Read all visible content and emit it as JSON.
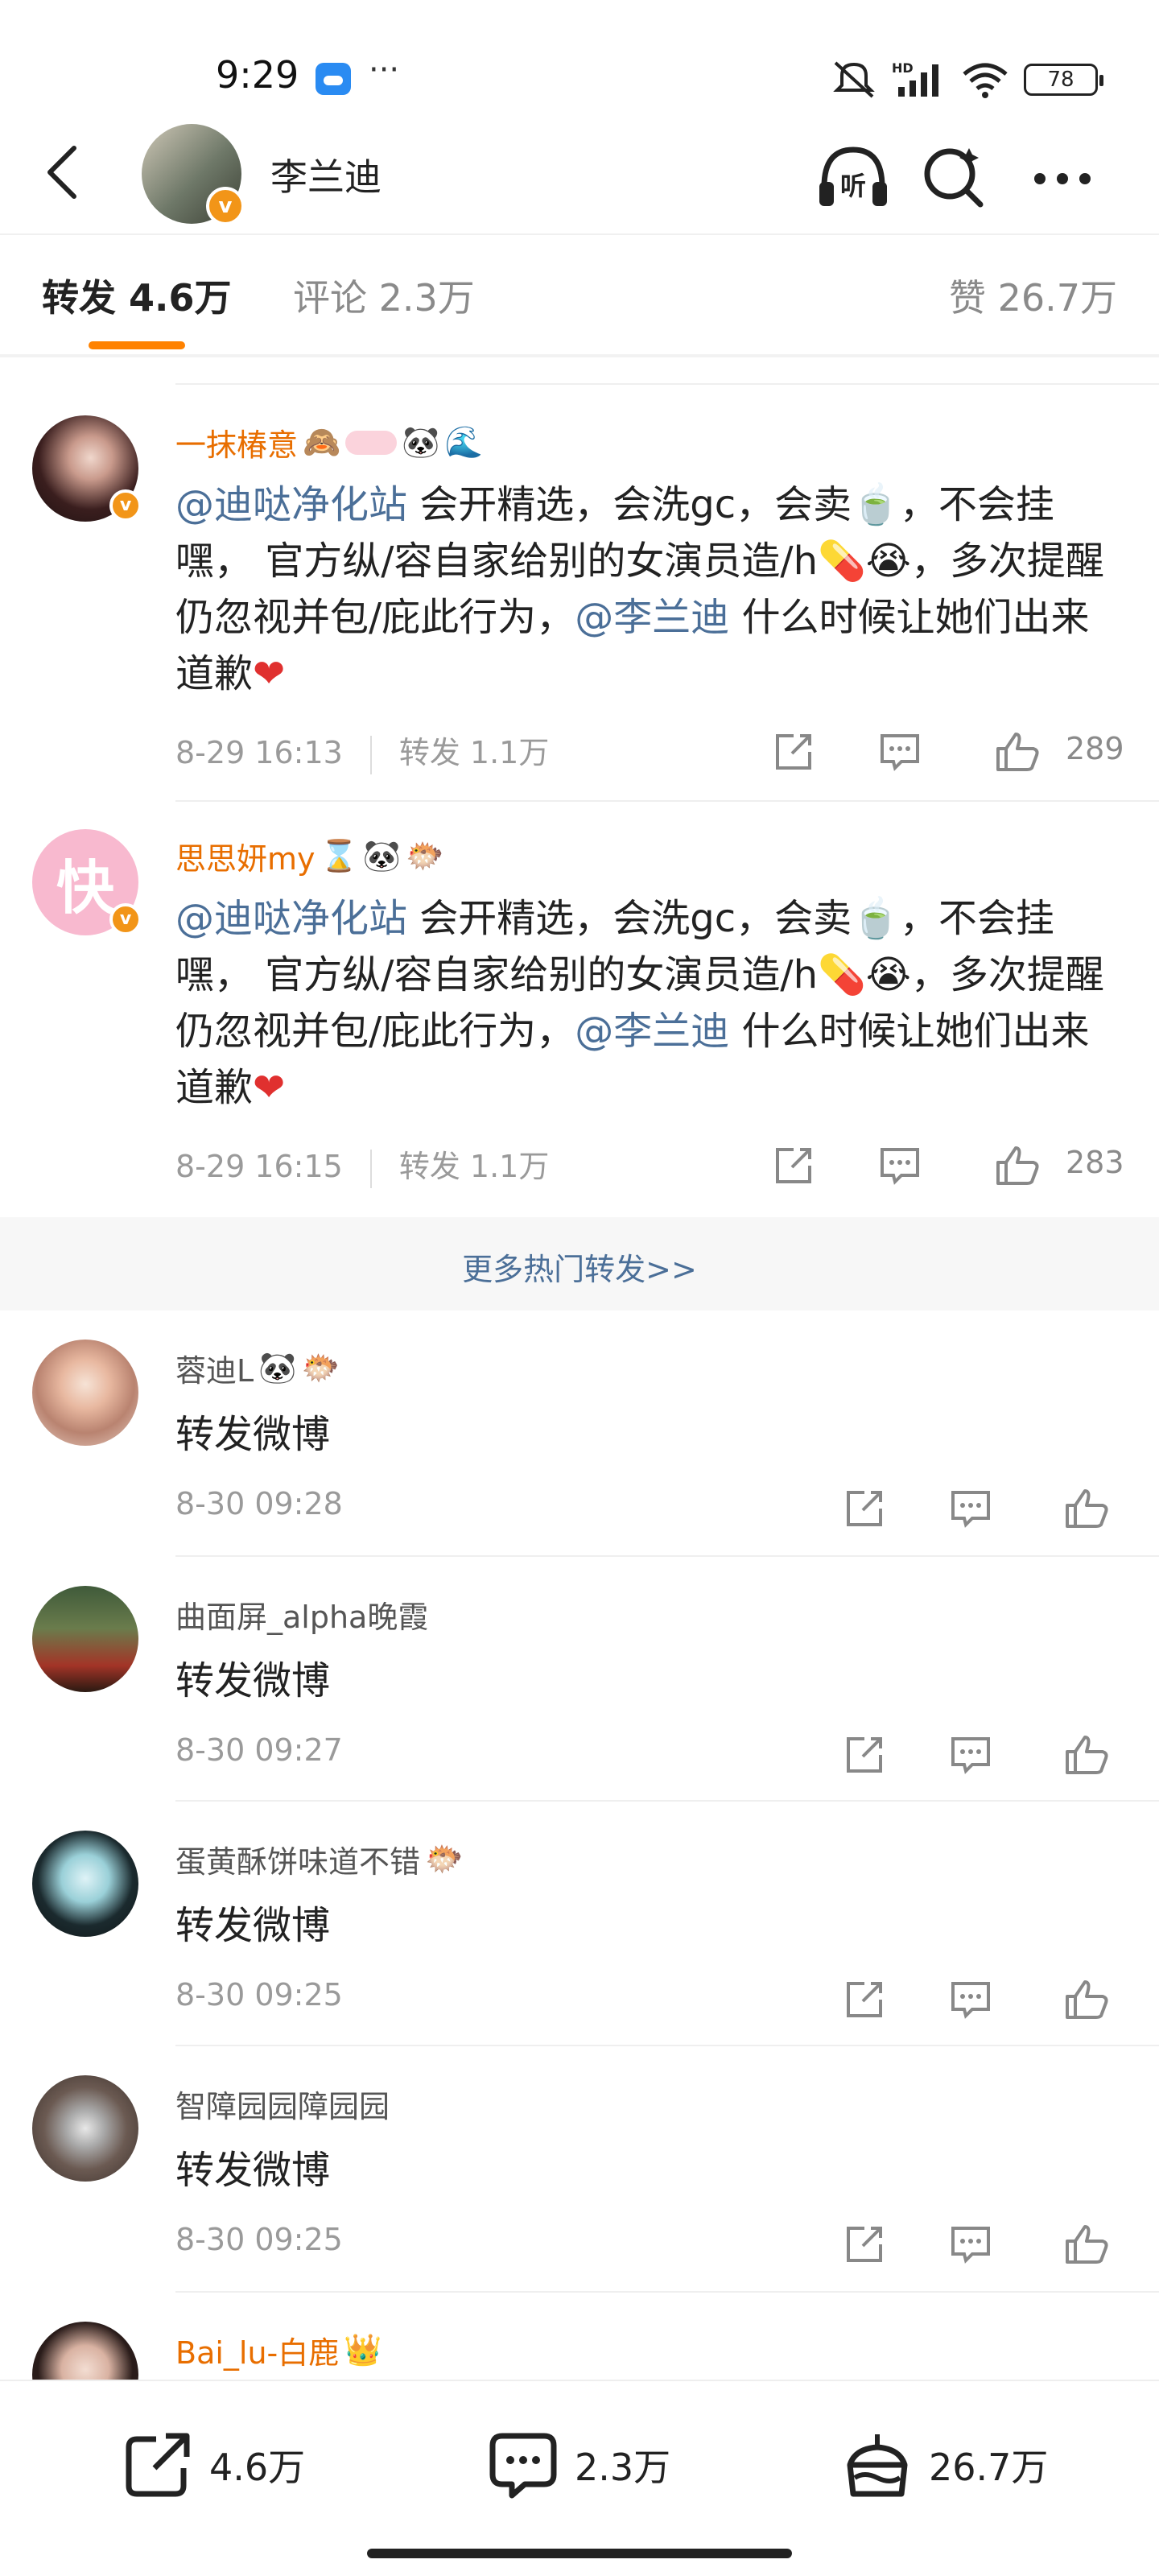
{
  "status_bar": {
    "time": "9:29",
    "more": "···",
    "battery": "78"
  },
  "header": {
    "name": "李兰迪"
  },
  "tabs": [
    {
      "label": "转发 4.6万"
    },
    {
      "label": "评论 2.3万"
    },
    {
      "label": "赞 26.7万"
    }
  ],
  "hot_reposts": [
    {
      "user": "一抹椿意",
      "mention1": "@迪哒净化站",
      "text1": " 会开精选，会洗gc，会卖",
      "text2": "，不会挂嘿， 官方纵/容自家给别的女演员造/h",
      "text3": "，多次提醒仍忽视并包/庇此行为，",
      "mention2": "@李兰迪",
      "text4": " 什么时候让她们出来道歉",
      "date": "8-29 16:13",
      "reposts": "转发 1.1万",
      "likes": "289"
    },
    {
      "user": "思思妍my",
      "avatar_char": "快",
      "mention1": "@迪哒净化站",
      "text1": " 会开精选，会洗gc，会卖",
      "text2": "，不会挂嘿， 官方纵/容自家给别的女演员造/h",
      "text3": "，多次提醒仍忽视并包/庇此行为，",
      "mention2": "@李兰迪",
      "text4": " 什么时候让她们出来道歉",
      "date": "8-29 16:15",
      "reposts": "转发 1.1万",
      "likes": "283"
    }
  ],
  "more_hot_label": "更多热门转发>>",
  "reposts": [
    {
      "user": "蓉迪L",
      "text": "转发微博",
      "date": "8-30 09:28"
    },
    {
      "user": "曲面屏_alpha晚霞",
      "text": "转发微博",
      "date": "8-30 09:27"
    },
    {
      "user": "蛋黄酥饼味道不错",
      "text": "转发微博",
      "date": "8-30 09:25"
    },
    {
      "user": "智障园园障园园",
      "text": "转发微博",
      "date": "8-30 09:25"
    },
    {
      "user": "Bai_lu-白鹿",
      "text": "",
      "date": ""
    }
  ],
  "bottom_bar": {
    "repost_count": "4.6万",
    "comment_count": "2.3万",
    "like_count": "26.7万"
  },
  "colors": {
    "accent": "#ff8200",
    "link": "#4b6f98",
    "username_orange": "#e86e00",
    "verified_badge": "#f29518"
  }
}
